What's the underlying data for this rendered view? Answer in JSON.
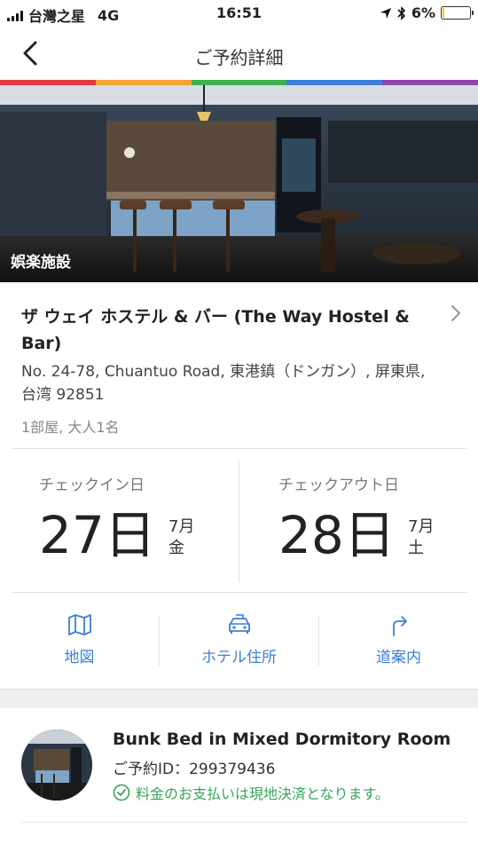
{
  "status_bar": {
    "carrier": "台灣之星",
    "network": "4G",
    "time": "16:51",
    "battery": "6%",
    "battery_level": 0.06
  },
  "header": {
    "title": "ご予約詳細"
  },
  "rainbow_colors": [
    "#e23b3b",
    "#f0a43a",
    "#3eb14a",
    "#3b7fd8",
    "#8e44ad"
  ],
  "hero": {
    "category_tag": "娯楽施設"
  },
  "hotel": {
    "name": "ザ ウェイ ホステル & バー (The Way Hostel & Bar)",
    "address": "No. 24-78, Chuantuo Road, 東港鎮（ドンガン）, 屏東県, 台湾 92851",
    "guests": "1部屋, 大人1名"
  },
  "dates": {
    "checkin": {
      "label": "チェックイン日",
      "day": "27日",
      "month": "7月",
      "weekday": "金"
    },
    "checkout": {
      "label": "チェックアウト日",
      "day": "28日",
      "month": "7月",
      "weekday": "土"
    }
  },
  "actions": [
    {
      "label": "地図",
      "icon": "map-icon"
    },
    {
      "label": "ホテル住所",
      "icon": "taxi-icon"
    },
    {
      "label": "道案内",
      "icon": "directions-icon"
    }
  ],
  "room": {
    "title": "Bunk Bed in Mixed Dormitory Room",
    "booking_id": "ご予約ID：299379436",
    "payment_note": "料金のお支払いは現地決済となります。"
  },
  "colors": {
    "accent": "#3b7fd8",
    "success": "#3aa35a"
  }
}
